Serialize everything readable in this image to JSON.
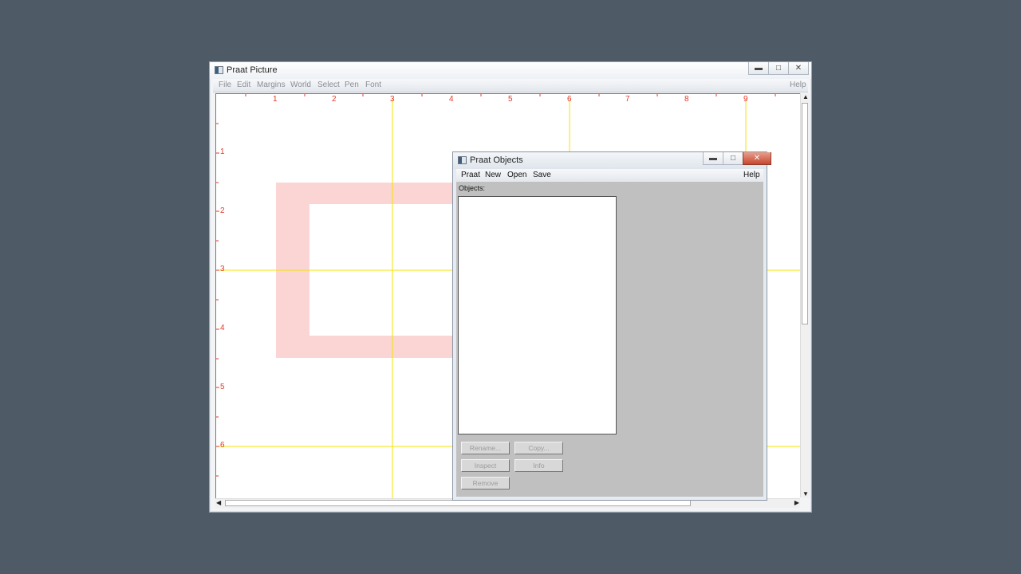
{
  "picture_window": {
    "title": "Praat Picture",
    "menu": [
      "File",
      "Edit",
      "Margins",
      "World",
      "Select",
      "Pen",
      "Font"
    ],
    "help": "Help",
    "ruler_x": [
      "1",
      "2",
      "3",
      "4",
      "5",
      "6",
      "7",
      "8",
      "9"
    ],
    "ruler_y": [
      "1",
      "2",
      "3",
      "4",
      "5",
      "6"
    ],
    "colors": {
      "ruler": "#e03a2a",
      "yellow_line": "#f5e300",
      "selection": "#fbd5d4"
    }
  },
  "objects_window": {
    "title": "Praat Objects",
    "menu": [
      "Praat",
      "New",
      "Open",
      "Save"
    ],
    "help": "Help",
    "objects_label": "Objects:",
    "buttons": {
      "rename": "Rename...",
      "copy": "Copy...",
      "inspect": "Inspect",
      "info": "Info",
      "remove": "Remove"
    }
  },
  "icons": {
    "minimize": "minimize-icon",
    "maximize": "maximize-icon",
    "close": "close-icon"
  }
}
